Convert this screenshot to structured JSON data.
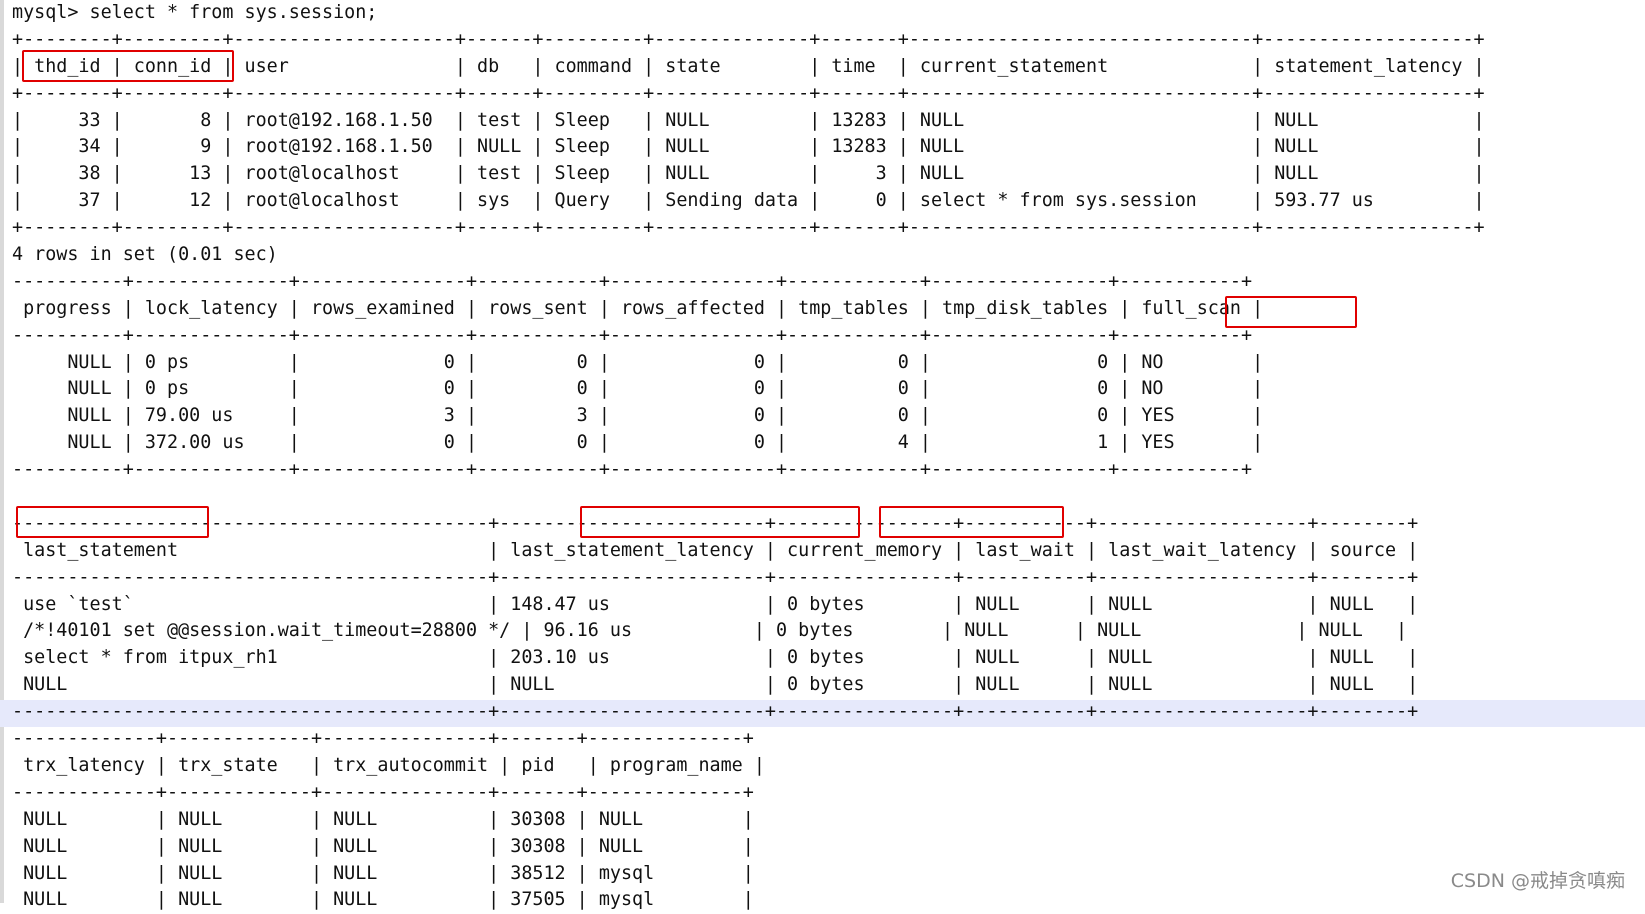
{
  "terminal": {
    "lines": [
      "mysql> select * from sys.session;",
      "+--------+---------+--------------------+------+---------+--------------+-------+-------------------------------+-------------------+",
      "| thd_id | conn_id | user               | db   | command | state        | time  | current_statement             | statement_latency |",
      "+--------+---------+--------------------+------+---------+--------------+-------+-------------------------------+-------------------+",
      "|     33 |       8 | root@192.168.1.50  | test | Sleep   | NULL         | 13283 | NULL                          | NULL              |",
      "|     34 |       9 | root@192.168.1.50  | NULL | Sleep   | NULL         | 13283 | NULL                          | NULL              |",
      "|     38 |      13 | root@localhost     | test | Sleep   | NULL         |     3 | NULL                          | NULL              |",
      "|     37 |      12 | root@localhost     | sys  | Query   | Sending data |     0 | select * from sys.session     | 593.77 us         |",
      "+--------+---------+--------------------+------+---------+--------------+-------+-------------------------------+-------------------+",
      "4 rows in set (0.01 sec)",
      "----------+--------------+---------------+-----------+---------------+------------+----------------+-----------+",
      " progress | lock_latency | rows_examined | rows_sent | rows_affected | tmp_tables | tmp_disk_tables | full_scan |",
      "----------+--------------+---------------+-----------+---------------+------------+----------------+-----------+",
      "     NULL | 0 ps         |             0 |         0 |             0 |          0 |               0 | NO        |",
      "     NULL | 0 ps         |             0 |         0 |             0 |          0 |               0 | NO        |",
      "     NULL | 79.00 us     |             3 |         3 |             0 |          0 |               0 | YES       |",
      "     NULL | 372.00 us    |             0 |         0 |             0 |          4 |               1 | YES       |",
      "----------+--------------+---------------+-----------+---------------+------------+----------------+-----------+",
      "",
      "-------------------------------------------+------------------------+----------------+-----------+-------------------+--------+",
      " last_statement                            | last_statement_latency | current_memory | last_wait | last_wait_latency | source |",
      "-------------------------------------------+------------------------+----------------+-----------+-------------------+--------+",
      " use `test`                                | 148.47 us              | 0 bytes        | NULL      | NULL              | NULL   |",
      " /*!40101 set @@session.wait_timeout=28800 */ | 96.16 us           | 0 bytes        | NULL      | NULL              | NULL   |",
      " select * from itpux_rh1                   | 203.10 us              | 0 bytes        | NULL      | NULL              | NULL   |",
      " NULL                                      | NULL                   | 0 bytes        | NULL      | NULL              | NULL   |",
      "-------------------------------------------+------------------------+----------------+-----------+-------------------+--------+",
      "-------------+-------------+---------------+-------+--------------+",
      " trx_latency | trx_state   | trx_autocommit | pid   | program_name |",
      "-------------+-------------+---------------+-------+--------------+",
      " NULL        | NULL        | NULL          | 30308 | NULL         |",
      " NULL        | NULL        | NULL          | 30308 | NULL         |",
      " NULL        | NULL        | NULL          | 38512 | mysql        |",
      " NULL        | NULL        | NULL          | 37505 | mysql        |"
    ]
  },
  "watermark": "CSDN @戒掉贪嗔痴"
}
